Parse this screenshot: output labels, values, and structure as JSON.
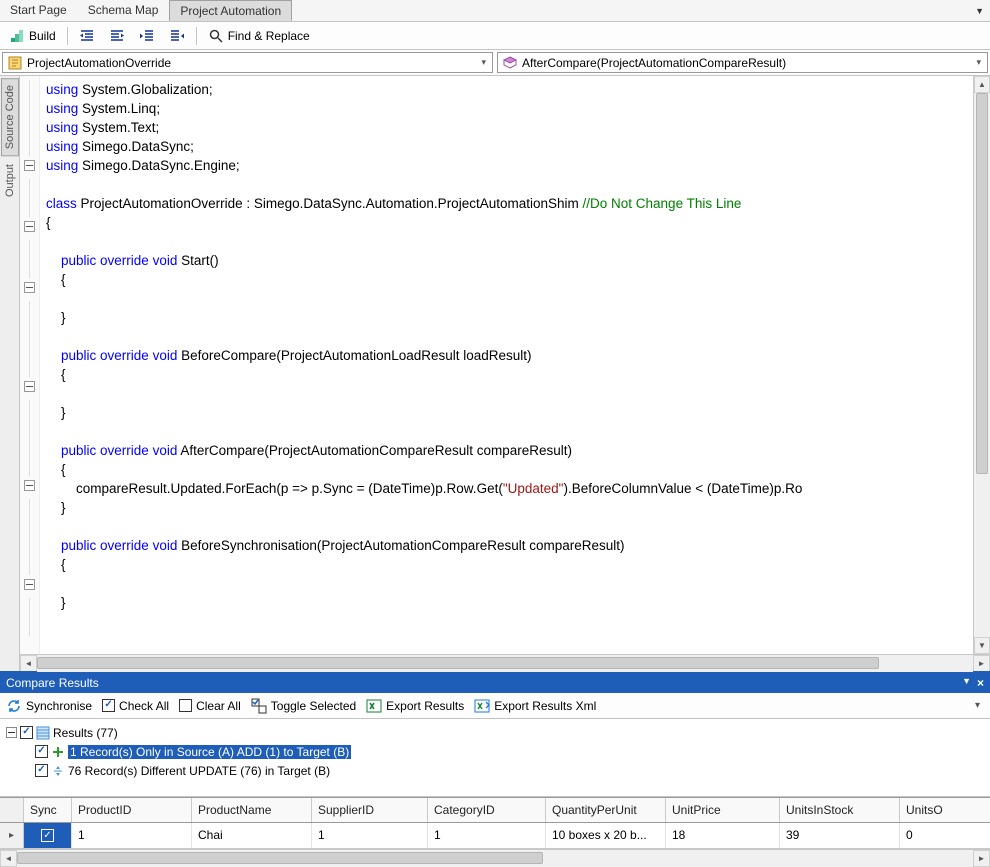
{
  "tabs": {
    "items": [
      "Start Page",
      "Schema Map",
      "Project Automation"
    ],
    "active_index": 2
  },
  "toolbar": {
    "build_label": "Build",
    "find_replace_label": "Find & Replace"
  },
  "selectors": {
    "left": "ProjectAutomationOverride",
    "right": "AfterCompare(ProjectAutomationCompareResult)"
  },
  "side_tabs": {
    "items": [
      "Source Code",
      "Output"
    ],
    "active_index": 0
  },
  "code": {
    "lines": [
      {
        "indent": 0,
        "tokens": [
          {
            "t": "using ",
            "c": "kw"
          },
          {
            "t": "System.Globalization;",
            "c": ""
          }
        ]
      },
      {
        "indent": 0,
        "tokens": [
          {
            "t": "using ",
            "c": "kw"
          },
          {
            "t": "System.Linq;",
            "c": ""
          }
        ]
      },
      {
        "indent": 0,
        "tokens": [
          {
            "t": "using ",
            "c": "kw"
          },
          {
            "t": "System.Text;",
            "c": ""
          }
        ]
      },
      {
        "indent": 0,
        "tokens": [
          {
            "t": "using ",
            "c": "kw"
          },
          {
            "t": "Simego.DataSync;",
            "c": ""
          }
        ]
      },
      {
        "indent": 0,
        "tokens": [
          {
            "t": "using ",
            "c": "kw"
          },
          {
            "t": "Simego.DataSync.Engine;",
            "c": ""
          }
        ]
      },
      {
        "indent": 0,
        "tokens": [
          {
            "t": "",
            "c": ""
          }
        ]
      },
      {
        "indent": 0,
        "tokens": [
          {
            "t": "class ",
            "c": "kw"
          },
          {
            "t": "ProjectAutomationOverride : Simego.DataSync.Automation.ProjectAutomationShim ",
            "c": ""
          },
          {
            "t": "//Do Not Change This Line",
            "c": "cm"
          }
        ]
      },
      {
        "indent": 0,
        "tokens": [
          {
            "t": "{",
            "c": ""
          }
        ]
      },
      {
        "indent": 0,
        "tokens": [
          {
            "t": "",
            "c": ""
          }
        ]
      },
      {
        "indent": 1,
        "tokens": [
          {
            "t": "public override void ",
            "c": "kw"
          },
          {
            "t": "Start()",
            "c": ""
          }
        ]
      },
      {
        "indent": 1,
        "tokens": [
          {
            "t": "{",
            "c": ""
          }
        ]
      },
      {
        "indent": 1,
        "tokens": [
          {
            "t": "",
            "c": ""
          }
        ]
      },
      {
        "indent": 1,
        "tokens": [
          {
            "t": "}",
            "c": ""
          }
        ]
      },
      {
        "indent": 0,
        "tokens": [
          {
            "t": "",
            "c": ""
          }
        ]
      },
      {
        "indent": 1,
        "tokens": [
          {
            "t": "public override void ",
            "c": "kw"
          },
          {
            "t": "BeforeCompare(ProjectAutomationLoadResult loadResult)",
            "c": ""
          }
        ]
      },
      {
        "indent": 1,
        "tokens": [
          {
            "t": "{",
            "c": ""
          }
        ]
      },
      {
        "indent": 1,
        "tokens": [
          {
            "t": "",
            "c": ""
          }
        ]
      },
      {
        "indent": 1,
        "tokens": [
          {
            "t": "}",
            "c": ""
          }
        ]
      },
      {
        "indent": 0,
        "tokens": [
          {
            "t": "",
            "c": ""
          }
        ]
      },
      {
        "indent": 1,
        "tokens": [
          {
            "t": "public override void ",
            "c": "kw"
          },
          {
            "t": "AfterCompare(ProjectAutomationCompareResult compareResult)",
            "c": ""
          }
        ]
      },
      {
        "indent": 1,
        "tokens": [
          {
            "t": "{",
            "c": ""
          }
        ]
      },
      {
        "indent": 2,
        "tokens": [
          {
            "t": "compareResult.Updated.ForEach(p => p.Sync = (DateTime)p.Row.Get(",
            "c": ""
          },
          {
            "t": "\"Updated\"",
            "c": "str"
          },
          {
            "t": ").BeforeColumnValue < (DateTime)p.Ro",
            "c": ""
          }
        ]
      },
      {
        "indent": 1,
        "tokens": [
          {
            "t": "}",
            "c": ""
          }
        ]
      },
      {
        "indent": 0,
        "tokens": [
          {
            "t": "",
            "c": ""
          }
        ]
      },
      {
        "indent": 1,
        "tokens": [
          {
            "t": "public override void ",
            "c": "kw"
          },
          {
            "t": "BeforeSynchronisation(ProjectAutomationCompareResult compareResult)",
            "c": ""
          }
        ]
      },
      {
        "indent": 1,
        "tokens": [
          {
            "t": "{",
            "c": ""
          }
        ]
      },
      {
        "indent": 1,
        "tokens": [
          {
            "t": "",
            "c": ""
          }
        ]
      },
      {
        "indent": 1,
        "tokens": [
          {
            "t": "}",
            "c": ""
          }
        ]
      }
    ],
    "fold_markers": [
      "",
      "",
      "",
      "",
      "-",
      "",
      "",
      "-",
      "",
      "",
      "-",
      "",
      "",
      "",
      "",
      "-",
      "",
      "",
      "",
      "",
      "-",
      "",
      "",
      "",
      "",
      "-",
      "",
      ""
    ]
  },
  "compare": {
    "panel_title": "Compare Results",
    "toolbar": {
      "synchronise": "Synchronise",
      "check_all": "Check All",
      "clear_all": "Clear All",
      "toggle_selected": "Toggle Selected",
      "export_results": "Export Results",
      "export_results_xml": "Export Results Xml"
    },
    "tree": {
      "root": "Results (77)",
      "children": [
        {
          "label": "1 Record(s) Only in Source (A) ADD (1) to Target (B)",
          "selected": true,
          "icon": "add"
        },
        {
          "label": "76 Record(s) Different UPDATE (76) in Target (B)",
          "selected": false,
          "icon": "diff"
        }
      ]
    },
    "grid": {
      "columns": [
        "Sync",
        "ProductID",
        "ProductName",
        "SupplierID",
        "CategoryID",
        "QuantityPerUnit",
        "UnitPrice",
        "UnitsInStock",
        "UnitsO"
      ],
      "rows": [
        {
          "sync": true,
          "ProductID": "1",
          "ProductName": "Chai",
          "SupplierID": "1",
          "CategoryID": "1",
          "QuantityPerUnit": "10 boxes x 20 b...",
          "UnitPrice": "18",
          "UnitsInStock": "39",
          "UnitsO": "0"
        }
      ]
    }
  }
}
